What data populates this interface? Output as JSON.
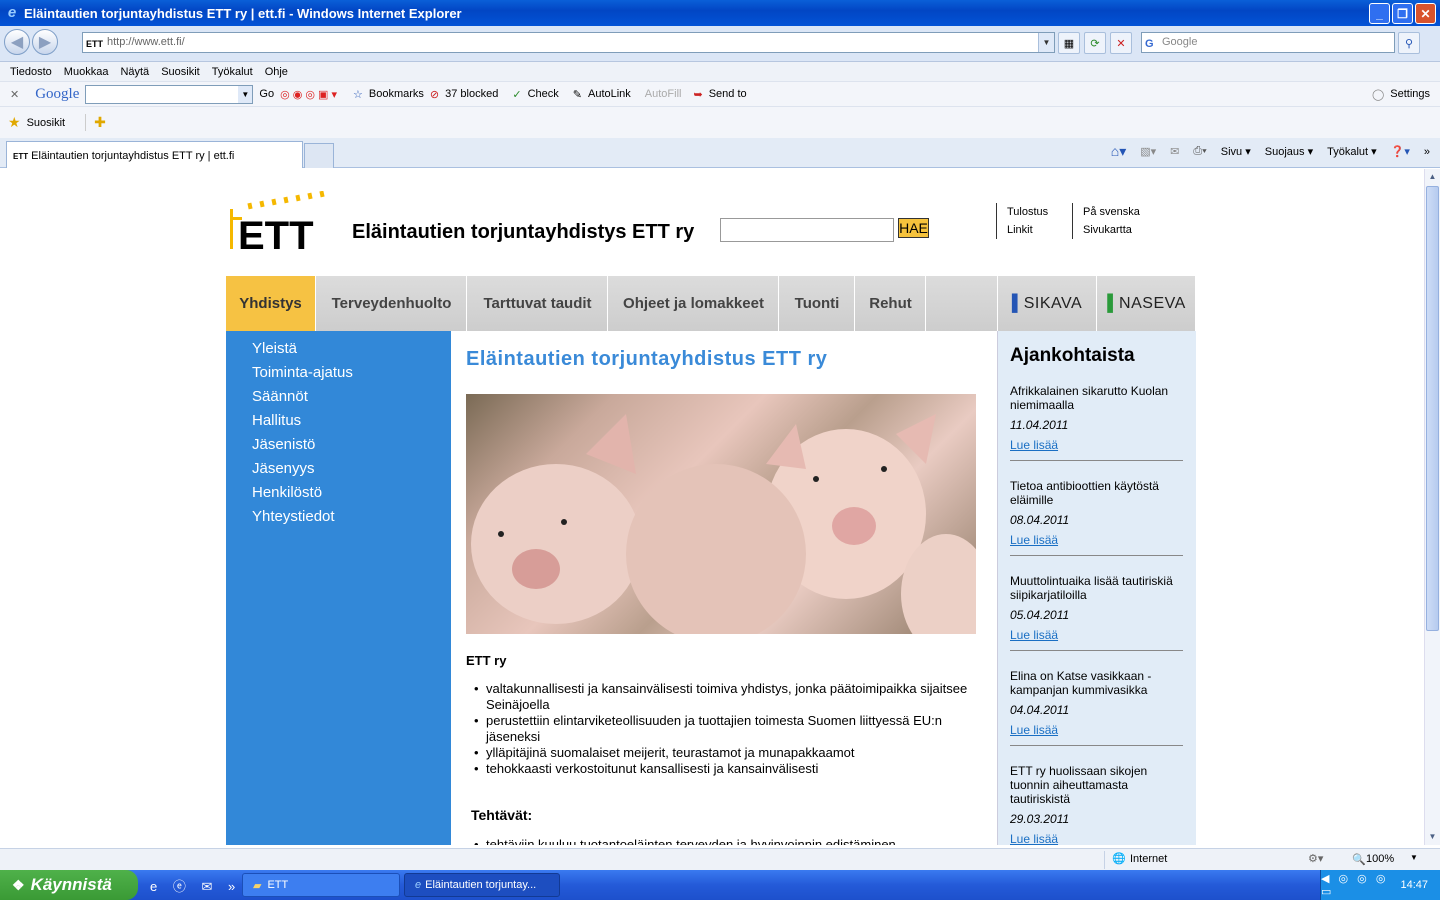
{
  "window": {
    "title": "Eläintautien torjuntayhdistus ETT ry | ett.fi - Windows Internet Explorer"
  },
  "address": {
    "url": "http://www.ett.fi/",
    "search_placeholder": "Google"
  },
  "menu": [
    "Tiedosto",
    "Muokkaa",
    "Näytä",
    "Suosikit",
    "Työkalut",
    "Ohje"
  ],
  "google_toolbar": {
    "brand": "Google",
    "go": "Go",
    "bookmarks": "Bookmarks",
    "blocked": "37 blocked",
    "check": "Check",
    "autolink": "AutoLink",
    "autofill": "AutoFill",
    "sendto": "Send to",
    "settings": "Settings"
  },
  "favorites": {
    "label": "Suosikit"
  },
  "tab": {
    "title": "Eläintautien torjuntayhdistus ETT ry | ett.fi"
  },
  "commands": {
    "sivu": "Sivu",
    "suojaus": "Suojaus",
    "tyokalut": "Työkalut"
  },
  "site": {
    "name": "Eläintautien torjuntayhdistys ETT ry",
    "logo_text": "ETT",
    "search_button": "HAE",
    "links": {
      "tulostus": "Tulostus",
      "linkit": "Linkit",
      "svenska": "På svenska",
      "sivukartta": "Sivukartta"
    },
    "nav": [
      "Yhdistys",
      "Terveydenhuolto",
      "Tarttuvat taudit",
      "Ohjeet ja lomakkeet",
      "Tuonti",
      "Rehut"
    ],
    "nav_right": [
      "SIKAVA",
      "NASEVA"
    ],
    "sidebar": [
      "Yleistä",
      "Toiminta-ajatus",
      "Säännöt",
      "Hallitus",
      "Jäsenistö",
      "Jäsenyys",
      "Henkilöstö",
      "Yhteystiedot"
    ],
    "main": {
      "heading": "Eläintautien torjuntayhdistus ETT ry",
      "subheading": "ETT ry",
      "bullets": [
        "valtakunnallisesti ja kansainvälisesti toimiva yhdistys, jonka päätoimipaikka sijaitsee Seinäjoella",
        "perustettiin elintarviketeollisuuden ja tuottajien toimesta Suomen liittyessä EU:n jäseneksi",
        "ylläpitäjinä suomalaiset meijerit, teurastamot ja munapakkaamot",
        "tehokkaasti verkostoitunut kansallisesti ja kansainvälisesti"
      ],
      "tasks_heading": "Tehtävät:",
      "tasks_first": "tehtäviin kuuluu tuotantoeläinten terveyden ja hyvinvoinnin edistäminen"
    },
    "news": {
      "heading": "Ajankohtaista",
      "readmore": "Lue lisää",
      "items": [
        {
          "title": "Afrikkalainen sikarutto Kuolan niemimaalla",
          "date": "11.04.2011"
        },
        {
          "title": "Tietoa antibioottien käytöstä eläimille",
          "date": "08.04.2011"
        },
        {
          "title": "Muuttolintuaika lisää tautiriskiä siipikarjatiloilla",
          "date": "05.04.2011"
        },
        {
          "title": "Elina on Katse vasikkaan -kampanjan kummivasikka",
          "date": "04.04.2011"
        },
        {
          "title": "ETT ry huolissaan sikojen tuonnin aiheuttamasta tautiriskistä",
          "date": "29.03.2011"
        }
      ]
    }
  },
  "status": {
    "zone": "Internet",
    "zoom": "100%"
  },
  "taskbar": {
    "start": "Käynnistä",
    "task1": "ETT",
    "task2": "Eläintautien torjuntay...",
    "clock": "14:47"
  }
}
